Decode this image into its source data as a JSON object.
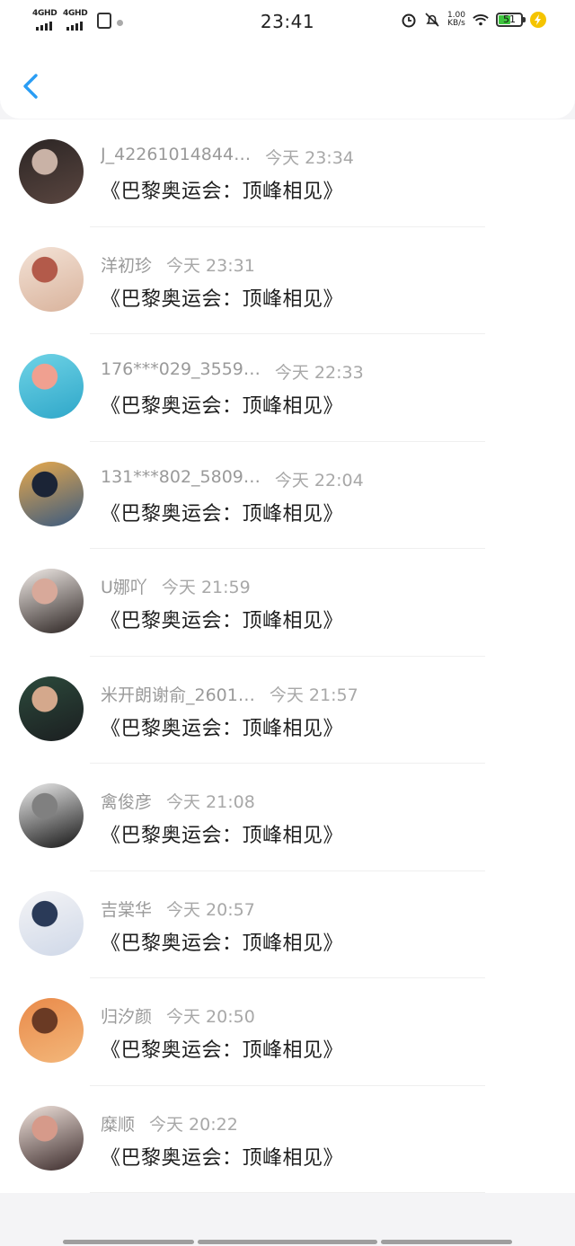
{
  "status_bar": {
    "signal_1_label": "4GHD",
    "signal_2_label": "4GHD",
    "time": "23:41",
    "net_speed_value": "1.00",
    "net_speed_unit": "KB/s",
    "battery_level": "51",
    "battery_color": "#3ec43e"
  },
  "nav": {
    "back_icon": "chevron-left-icon",
    "accent": "#2a9df4"
  },
  "items": [
    {
      "name": "J_42261014844…",
      "time": "今天 23:34",
      "message": "《巴黎奥运会：顶峰相见》",
      "avatar_colors": [
        "#2b2524",
        "#5a4640",
        "#c9b2a6"
      ]
    },
    {
      "name": "洋初珍",
      "time": "今天 23:31",
      "message": "《巴黎奥运会：顶峰相见》",
      "avatar_colors": [
        "#f3e2d6",
        "#d9b39c",
        "#b35a4a"
      ]
    },
    {
      "name": "176***029_3559…",
      "time": "今天 22:33",
      "message": "《巴黎奥运会：顶峰相见》",
      "avatar_colors": [
        "#6fd3e6",
        "#2fa7c9",
        "#f0a090"
      ]
    },
    {
      "name": "131***802_5809…",
      "time": "今天 22:04",
      "message": "《巴黎奥运会：顶峰相见》",
      "avatar_colors": [
        "#e7a94c",
        "#3a5a80",
        "#1b2436"
      ]
    },
    {
      "name": "U娜吖",
      "time": "今天 21:59",
      "message": "《巴黎奥运会：顶峰相见》",
      "avatar_colors": [
        "#f2ece8",
        "#2b2321",
        "#d8a99a"
      ]
    },
    {
      "name": "米开朗谢俞_2601…",
      "time": "今天 21:57",
      "message": "《巴黎奥运会：顶峰相见》",
      "avatar_colors": [
        "#2c4a3c",
        "#1b1e20",
        "#d4a88c"
      ]
    },
    {
      "name": "禽俊彦",
      "time": "今天 21:08",
      "message": "《巴黎奥运会：顶峰相见》",
      "avatar_colors": [
        "#ededed",
        "#151515",
        "#808080"
      ]
    },
    {
      "name": "吉棠华",
      "time": "今天 20:57",
      "message": "《巴黎奥运会：顶峰相见》",
      "avatar_colors": [
        "#f4f4f6",
        "#cfd8e8",
        "#2a3a58"
      ]
    },
    {
      "name": "归汐颜",
      "time": "今天 20:50",
      "message": "《巴黎奥运会：顶峰相见》",
      "avatar_colors": [
        "#e98a4a",
        "#f3b77a",
        "#6a3a24"
      ]
    },
    {
      "name": "糜顺",
      "time": "今天 20:22",
      "message": "《巴黎奥运会：顶峰相见》",
      "avatar_colors": [
        "#f1e3dc",
        "#3a2a2a",
        "#d69a8a"
      ]
    }
  ]
}
